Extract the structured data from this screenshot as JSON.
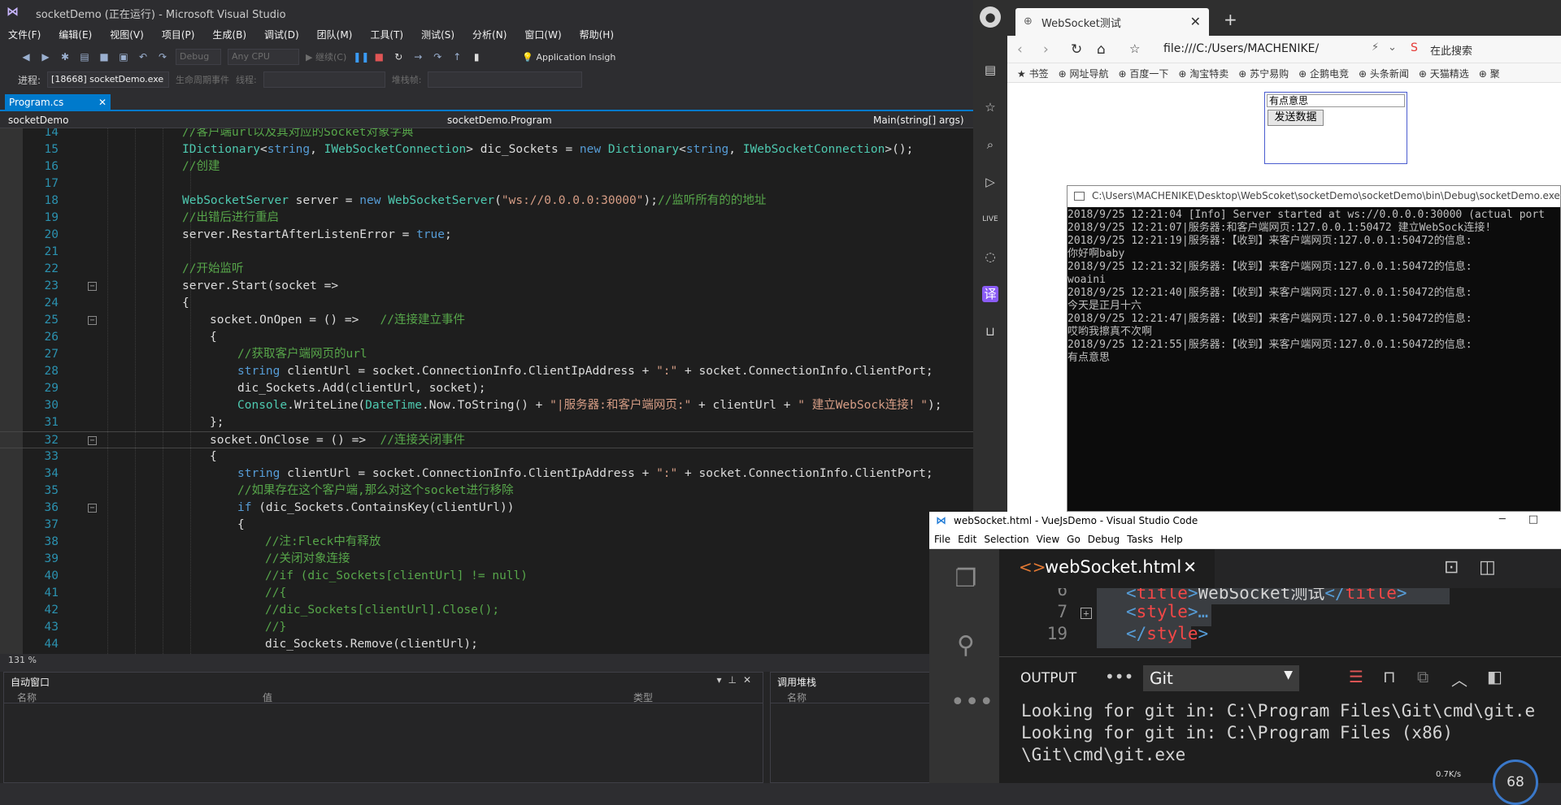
{
  "vs": {
    "title": "socketDemo (正在运行) - Microsoft Visual Studio",
    "menu": [
      "文件(F)",
      "编辑(E)",
      "视图(V)",
      "项目(P)",
      "生成(B)",
      "调试(D)",
      "团队(M)",
      "工具(T)",
      "测试(S)",
      "分析(N)",
      "窗口(W)",
      "帮助(H)"
    ],
    "toolbar": {
      "config": "Debug",
      "platform": "Any CPU",
      "continue": "继续(C)",
      "insights": "Application Insigh"
    },
    "toolbar2": {
      "process_label": "进程:",
      "process_value": "[18668] socketDemo.exe",
      "lifecycle": "生命周期事件",
      "thread_label": "线程:",
      "stackframe_label": "堆栈帧:"
    },
    "doc_tab": "Program.cs",
    "nav": {
      "project": "socketDemo",
      "class": "socketDemo.Program",
      "member": "Main(string[] args)"
    },
    "zoom": "131 %",
    "autos_pane": {
      "title": "自动窗口",
      "col_name": "名称",
      "col_value": "值",
      "col_type": "类型"
    },
    "callstack_pane": {
      "title": "调用堆栈",
      "col_name": "名称"
    }
  },
  "code": [
    {
      "n": "14",
      "html": "<span class='c'>//客户端url以及其对应的Socket对象字典</span>",
      "indent": 0
    },
    {
      "n": "15",
      "html": "<span class='t'>IDictionary</span><span class='p'>&lt;</span><span class='k'>string</span><span class='p'>, </span><span class='t'>IWebSocketConnection</span><span class='p'>&gt; dic_Sockets = </span><span class='k'>new</span><span class='p'> </span><span class='t'>Dictionary</span><span class='p'>&lt;</span><span class='k'>string</span><span class='p'>, </span><span class='t'>IWebSocketConnection</span><span class='p'>&gt;();</span>",
      "indent": 0
    },
    {
      "n": "16",
      "html": "<span class='c'>//创建</span>",
      "indent": 0
    },
    {
      "n": "17",
      "html": "",
      "indent": 0
    },
    {
      "n": "18",
      "html": "<span class='t'>WebSocketServer</span><span class='p'> server = </span><span class='k'>new</span><span class='p'> </span><span class='t'>WebSocketServer</span><span class='p'>(</span><span class='s'>\"ws://0.0.0.0:30000\"</span><span class='p'>);</span><span class='c'>//监听所有的的地址</span>",
      "indent": 0
    },
    {
      "n": "19",
      "html": "<span class='c'>//出错后进行重启</span>",
      "indent": 0
    },
    {
      "n": "20",
      "html": "<span class='p'>server.RestartAfterListenError = </span><span class='k'>true</span><span class='p'>;</span>",
      "indent": 0
    },
    {
      "n": "21",
      "html": "",
      "indent": 0
    },
    {
      "n": "22",
      "html": "<span class='c'>//开始监听</span>",
      "indent": 0
    },
    {
      "n": "23",
      "html": "<span class='p'>server.Start(socket =&gt;</span>",
      "indent": 0,
      "fold": true
    },
    {
      "n": "24",
      "html": "<span class='p'>{</span>",
      "indent": 0
    },
    {
      "n": "25",
      "html": "<span class='p'>socket.OnOpen = () =&gt;   </span><span class='c'>//连接建立事件</span>",
      "indent": 1,
      "fold": true
    },
    {
      "n": "26",
      "html": "<span class='p'>{</span>",
      "indent": 1
    },
    {
      "n": "27",
      "html": "<span class='c'>//获取客户端网页的url</span>",
      "indent": 2
    },
    {
      "n": "28",
      "html": "<span class='k'>string</span><span class='p'> clientUrl = socket.ConnectionInfo.ClientIpAddress + </span><span class='s'>\":\"</span><span class='p'> + socket.ConnectionInfo.ClientPort;</span>",
      "indent": 2
    },
    {
      "n": "29",
      "html": "<span class='p'>dic_Sockets.Add(clientUrl, socket);</span>",
      "indent": 2
    },
    {
      "n": "30",
      "html": "<span class='t'>Console</span><span class='p'>.WriteLine(</span><span class='t'>DateTime</span><span class='p'>.Now.ToString() + </span><span class='s'>\"|服务器:和客户端网页:\"</span><span class='p'> + clientUrl + </span><span class='s'>\" 建立WebSock连接！\"</span><span class='p'>);</span>",
      "indent": 2
    },
    {
      "n": "31",
      "html": "<span class='p'>};</span>",
      "indent": 1
    },
    {
      "n": "32",
      "html": "<span class='p'>socket.OnClose = () =&gt;  </span><span class='c'>//连接关闭事件</span>",
      "indent": 1,
      "fold": true,
      "current": true
    },
    {
      "n": "33",
      "html": "<span class='p'>{</span>",
      "indent": 1
    },
    {
      "n": "34",
      "html": "<span class='k'>string</span><span class='p'> clientUrl = socket.ConnectionInfo.ClientIpAddress + </span><span class='s'>\":\"</span><span class='p'> + socket.ConnectionInfo.ClientPort;</span>",
      "indent": 2
    },
    {
      "n": "35",
      "html": "<span class='c'>//如果存在这个客户端,那么对这个socket进行移除</span>",
      "indent": 2
    },
    {
      "n": "36",
      "html": "<span class='k'>if</span><span class='p'> (dic_Sockets.ContainsKey(clientUrl))</span>",
      "indent": 2,
      "fold": true
    },
    {
      "n": "37",
      "html": "<span class='p'>{</span>",
      "indent": 2
    },
    {
      "n": "38",
      "html": "<span class='c'>//注:Fleck中有释放</span>",
      "indent": 3
    },
    {
      "n": "39",
      "html": "<span class='c'>//关闭对象连接</span>",
      "indent": 3
    },
    {
      "n": "40",
      "html": "<span class='c'>//if (dic_Sockets[clientUrl] != null)</span>",
      "indent": 3
    },
    {
      "n": "41",
      "html": "<span class='c'>//{</span>",
      "indent": 3
    },
    {
      "n": "42",
      "html": "<span class='c'>//dic_Sockets[clientUrl].Close();</span>",
      "indent": 3
    },
    {
      "n": "43",
      "html": "<span class='c'>//}</span>",
      "indent": 3
    },
    {
      "n": "44",
      "html": "<span class='p'>dic_Sockets.Remove(clientUrl);</span>",
      "indent": 3
    }
  ],
  "browser": {
    "tab_title": "WebSocket测试",
    "url": "file:///C:/Users/MACHENIKE/",
    "search_placeholder": "在此搜索",
    "bookmarks": [
      "书签",
      "网址导航",
      "百度一下",
      "淘宝特卖",
      "苏宁易购",
      "企鹅电竞",
      "头条新闻",
      "天猫精选",
      "聚"
    ],
    "input_value": "有点意思",
    "send_button": "发送数据"
  },
  "console": {
    "title": "C:\\Users\\MACHENIKE\\Desktop\\WebScoket\\socketDemo\\socketDemo\\bin\\Debug\\socketDemo.exe",
    "lines": [
      "2018/9/25 12:21:04 [Info] Server started at ws://0.0.0.0:30000 (actual port",
      "2018/9/25 12:21:07|服务器:和客户端网页:127.0.0.1:50472 建立WebSock连接!",
      "2018/9/25 12:21:19|服务器:【收到】来客户端网页:127.0.0.1:50472的信息:",
      "你好啊baby",
      "2018/9/25 12:21:32|服务器:【收到】来客户端网页:127.0.0.1:50472的信息:",
      "woaini",
      "2018/9/25 12:21:40|服务器:【收到】来客户端网页:127.0.0.1:50472的信息:",
      "今天是正月十六",
      "2018/9/25 12:21:47|服务器:【收到】来客户端网页:127.0.0.1:50472的信息:",
      "哎哟我擦真不次啊",
      "2018/9/25 12:21:55|服务器:【收到】来客户端网页:127.0.0.1:50472的信息:",
      "有点意思"
    ]
  },
  "vscode": {
    "title": "webSocket.html - VueJsDemo - Visual Studio Code",
    "menu": [
      "File",
      "Edit",
      "Selection",
      "View",
      "Go",
      "Debug",
      "Tasks",
      "Help"
    ],
    "tab": "webSocket.html",
    "lines": [
      {
        "n": "6",
        "open": "<",
        "tag": "title",
        "close": ">",
        "text": "WebSocket测试",
        "end": "</",
        "etag": "title",
        "eclose": ">"
      },
      {
        "n": "7",
        "open": "<",
        "tag": "style",
        "close": ">",
        "text": "…"
      },
      {
        "n": "19",
        "open": "</",
        "tag": "style",
        "close": ">"
      }
    ],
    "output_label": "OUTPUT",
    "output_channel": "Git",
    "output": [
      "Looking for git in: C:\\Program Files\\Git\\cmd\\git.e",
      "Looking for git in: C:\\Program Files (x86)",
      "\\Git\\cmd\\git.exe"
    ],
    "net_speed": "0.7K/s",
    "net_value": "68"
  }
}
